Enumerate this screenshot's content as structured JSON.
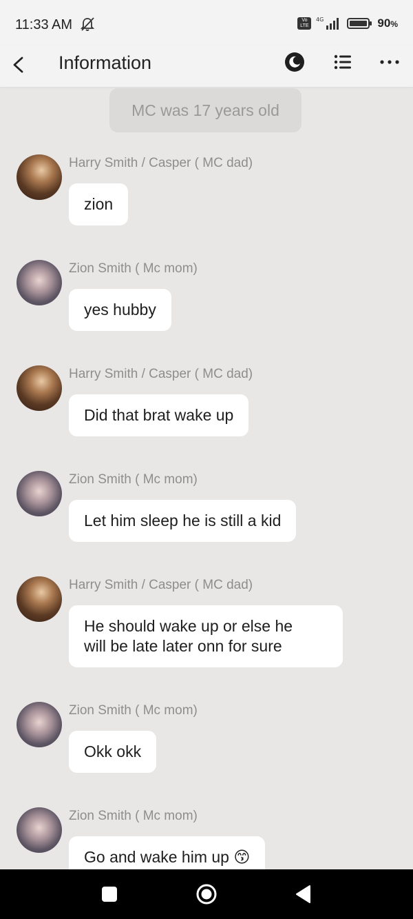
{
  "status": {
    "time": "11:33 AM",
    "network": "4G",
    "lte_label": "Vo LTE",
    "battery": "90",
    "battery_unit": "%"
  },
  "appbar": {
    "title": "Information"
  },
  "chat": {
    "narration": "MC was 17 years old",
    "messages": [
      {
        "sender": "Harry Smith / Casper ( MC dad)",
        "text": "zion",
        "avatar": "dad"
      },
      {
        "sender": "Zion Smith  ( Mc mom)",
        "text": "yes hubby",
        "avatar": "mom"
      },
      {
        "sender": "Harry Smith / Casper ( MC dad)",
        "text": "Did that brat wake up",
        "avatar": "dad"
      },
      {
        "sender": "Zion Smith  ( Mc mom)",
        "text": "Let him sleep he is still a kid",
        "avatar": "mom"
      },
      {
        "sender": "Harry Smith / Casper ( MC dad)",
        "text_line1": "He should wake up or else he",
        "text_line2": "will be late later onn for sure",
        "avatar": "dad"
      },
      {
        "sender": "Zion Smith  ( Mc mom)",
        "text": "Okk okk",
        "avatar": "mom"
      },
      {
        "sender": "Zion Smith  ( Mc mom)",
        "text": "Go and wake him up 😙",
        "avatar": "mom"
      }
    ]
  },
  "icons": {
    "back": "back-arrow-icon",
    "night": "night-mode-icon",
    "list": "list-icon",
    "more": "more-icon"
  }
}
